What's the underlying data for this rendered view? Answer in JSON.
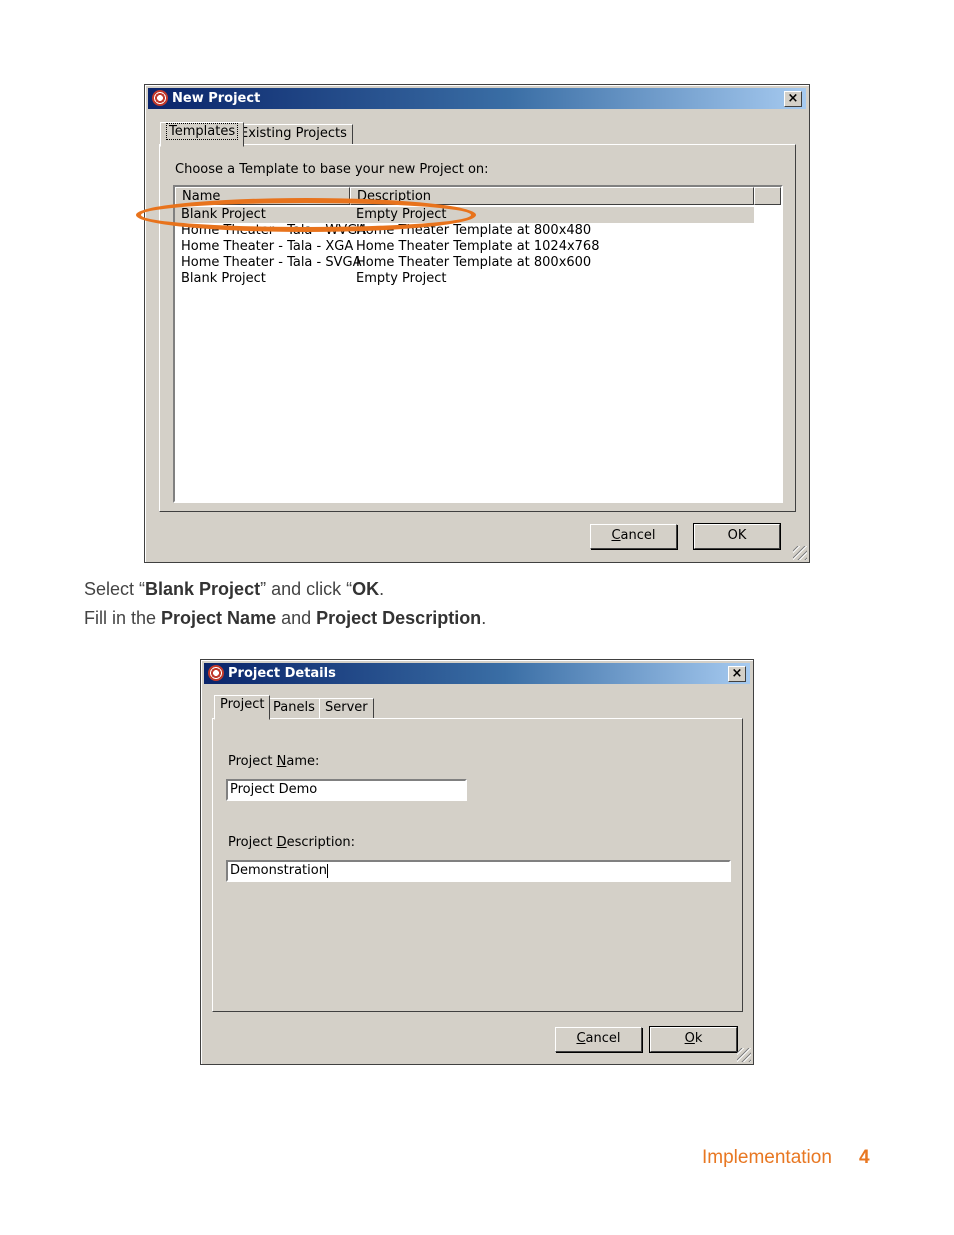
{
  "new_project_dialog": {
    "title": "New Project",
    "tabs": [
      {
        "label": "Templates",
        "active": true
      },
      {
        "label": "Existing Projects",
        "active": false
      }
    ],
    "prompt": "Choose a Template to base your new Project on:",
    "columns": [
      "Name",
      "Description"
    ],
    "rows": [
      {
        "name": "Blank Project",
        "description": "Empty Project",
        "selected": true
      },
      {
        "name": "Home Theater - Tala - WVGA",
        "description": "Home Theater Template at 800x480",
        "selected": false
      },
      {
        "name": "Home Theater - Tala - XGA",
        "description": "Home Theater Template at 1024x768",
        "selected": false
      },
      {
        "name": "Home Theater - Tala - SVGA",
        "description": "Home Theater Template at 800x600",
        "selected": false
      },
      {
        "name": "Blank Project",
        "description": "Empty Project",
        "selected": false
      }
    ],
    "cancel_label_pre": "",
    "cancel_label_ul": "C",
    "cancel_label_post": "ancel",
    "ok_label": "OK"
  },
  "instructions": {
    "line1_pre": "Select “",
    "line1_bold1": "Blank Project",
    "line1_mid": "” and click “",
    "line1_bold2": "OK",
    "line1_post": ".",
    "line2_pre": "Fill in the ",
    "line2_bold1": "Project Name",
    "line2_mid": " and ",
    "line2_bold2": "Project Description",
    "line2_post": "."
  },
  "project_details_dialog": {
    "title": "Project Details",
    "tabs": [
      {
        "label": "Project",
        "active": true
      },
      {
        "label": "Panels",
        "active": false
      },
      {
        "label": "Server",
        "active": false
      }
    ],
    "name_label_pre": "Project ",
    "name_label_ul": "N",
    "name_label_post": "ame:",
    "name_value": "Project Demo",
    "desc_label_pre": "Project ",
    "desc_label_ul": "D",
    "desc_label_post": "escription:",
    "desc_value": "Demonstration",
    "cancel_label_ul": "C",
    "cancel_label_post": "ancel",
    "ok_label_ul": "O",
    "ok_label_post": "k"
  },
  "footer": {
    "section": "Implementation",
    "page": "4"
  },
  "colors": {
    "accent": "#e87722",
    "titlebar_start": "#0a246a",
    "titlebar_end": "#a6caf0"
  }
}
